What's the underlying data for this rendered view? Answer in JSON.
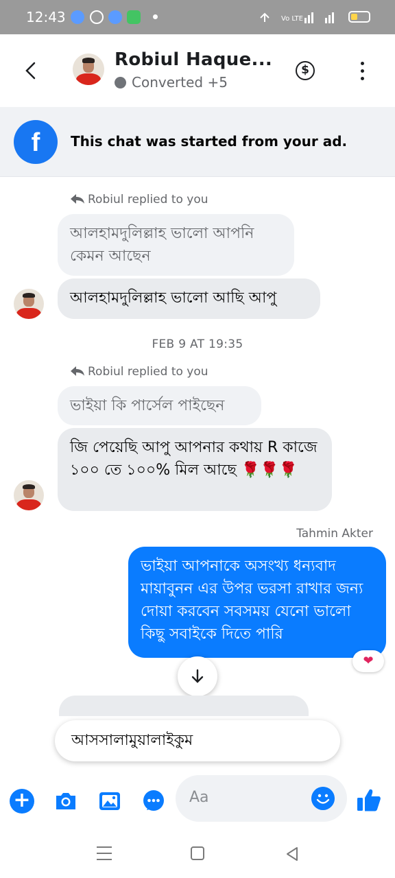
{
  "status_bar": {
    "time": "12:43"
  },
  "header": {
    "contact_name": "Robiul Haque...",
    "status": "Converted +5",
    "icons": [
      "back-icon",
      "dollar-icon",
      "more-icon"
    ]
  },
  "ad_banner": {
    "text": "This chat was started from your ad."
  },
  "messages": [
    {
      "reply_note": "Robiul replied to you",
      "quoted": "আলহামদুলিল্লাহ ভালো আপনি কেমন আছেন",
      "text": "আলহামদুলিল্লাহ ভালো আছি আপু"
    },
    {
      "reply_note": "Robiul replied to you",
      "quoted": "ভাইয়া কি পার্সেল পাইছেন",
      "text": "জি পেয়েছি আপু আপনার কথায় R কাজে ১০০ তে ১০০% মিল আছে 🌹🌹🌹"
    }
  ],
  "timestamp": "FEB 9 AT 19:35",
  "outgoing": {
    "sender": "Tahmin Akter",
    "text": "ভাইয়া আপনাকে অসংখ্য ধন্যবাদ মায়াবুনন এর উপর ভরসা রাখার জন্য দোয়া করবেন সবসময় যেনো ভালো কিছু সবাইকে দিতে পারি",
    "reaction": "❤"
  },
  "suggested_reply": "আসসালামুয়ালাইকুম",
  "composer": {
    "placeholder": "Aa"
  },
  "colors": {
    "messenger_blue": "#0a7cff",
    "facebook_blue": "#1877f2"
  }
}
